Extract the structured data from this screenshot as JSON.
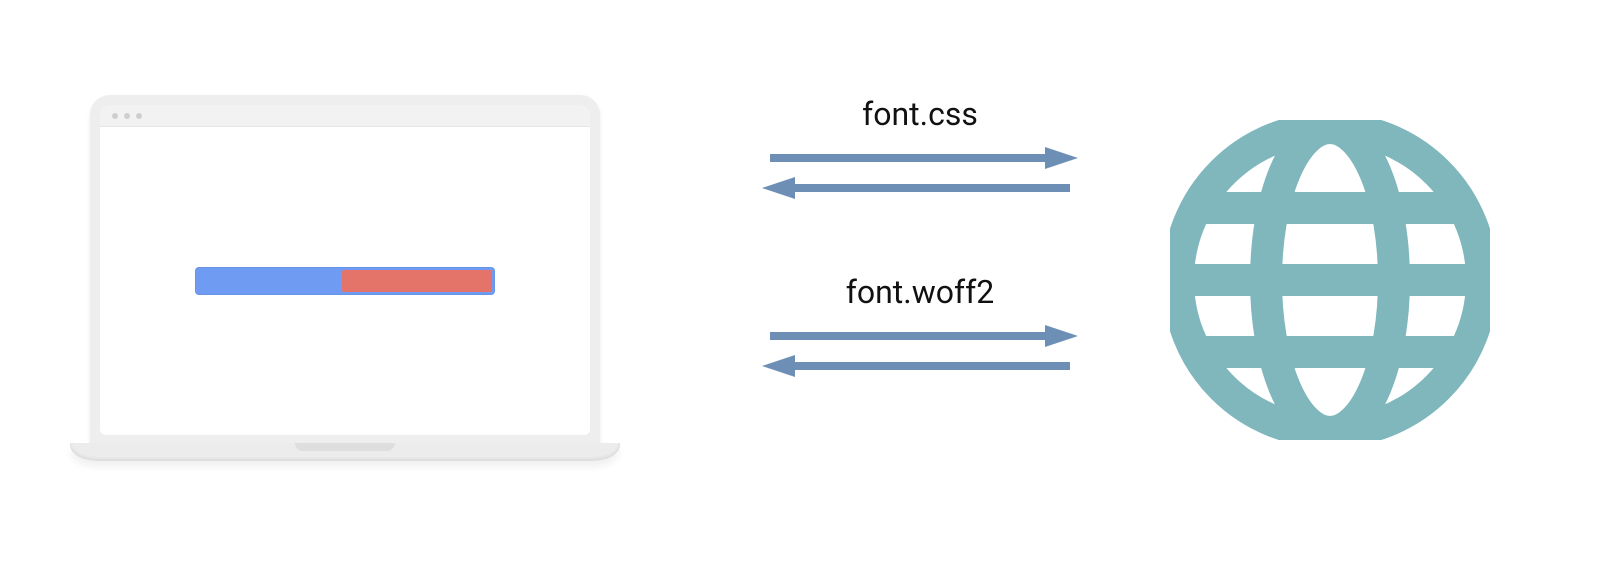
{
  "colors": {
    "arrow": "#6d8fb5",
    "globe": "#7fb7bd",
    "progress_track": "#6f9cf2",
    "progress_fill": "#e4736a",
    "laptop_body": "#eeeeee"
  },
  "requests": [
    {
      "label": "font.css"
    },
    {
      "label": "font.woff2"
    }
  ],
  "icons": {
    "left": "laptop-browser",
    "right": "globe"
  },
  "progress": {
    "value_pct": 50
  }
}
